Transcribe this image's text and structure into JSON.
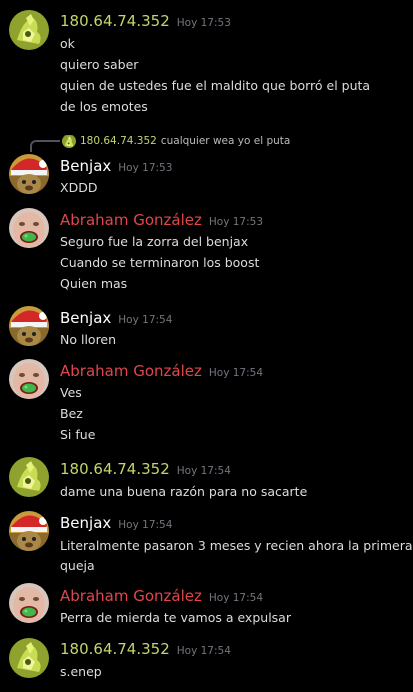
{
  "colors": {
    "background": "#000000",
    "ip_user": "#c6d46c",
    "benjax_user": "#ffffff",
    "abraham_user": "#e0474c",
    "message_text": "#dcddde",
    "timestamp": "#72767d"
  },
  "reply": {
    "author": "180.64.74.352",
    "text": "cualquier wea yo el puta"
  },
  "messages": [
    {
      "author": "180.64.74.352",
      "time": "Hoy 17:53",
      "lines": [
        "ok",
        "quiero saber",
        "quien de ustedes fue el maldito que borró el puta",
        "de los emotes"
      ]
    },
    {
      "author": "Benjax",
      "time": "Hoy 17:53",
      "lines": [
        "XDDD"
      ]
    },
    {
      "author": "Abraham González",
      "time": "Hoy 17:53",
      "lines": [
        "Seguro fue la zorra del benjax",
        "Cuando se terminaron los boost",
        "Quien mas"
      ]
    },
    {
      "author": "Benjax",
      "time": "Hoy 17:54",
      "lines": [
        "No lloren"
      ]
    },
    {
      "author": "Abraham González",
      "time": "Hoy 17:54",
      "lines": [
        "Ves",
        "Bez",
        "Si fue"
      ]
    },
    {
      "author": "180.64.74.352",
      "time": "Hoy 17:54",
      "lines": [
        "dame una buena razón para no sacarte"
      ]
    },
    {
      "author": "Benjax",
      "time": "Hoy 17:54",
      "lines": [
        "Literalmente pasaron 3 meses y recien ahora la primera",
        "queja"
      ]
    },
    {
      "author": "Abraham González",
      "time": "Hoy 17:54",
      "lines": [
        "Perra de mierda te vamos a expulsar"
      ]
    },
    {
      "author": "180.64.74.352",
      "time": "Hoy 17:54",
      "lines": [
        "s.enep"
      ]
    }
  ]
}
